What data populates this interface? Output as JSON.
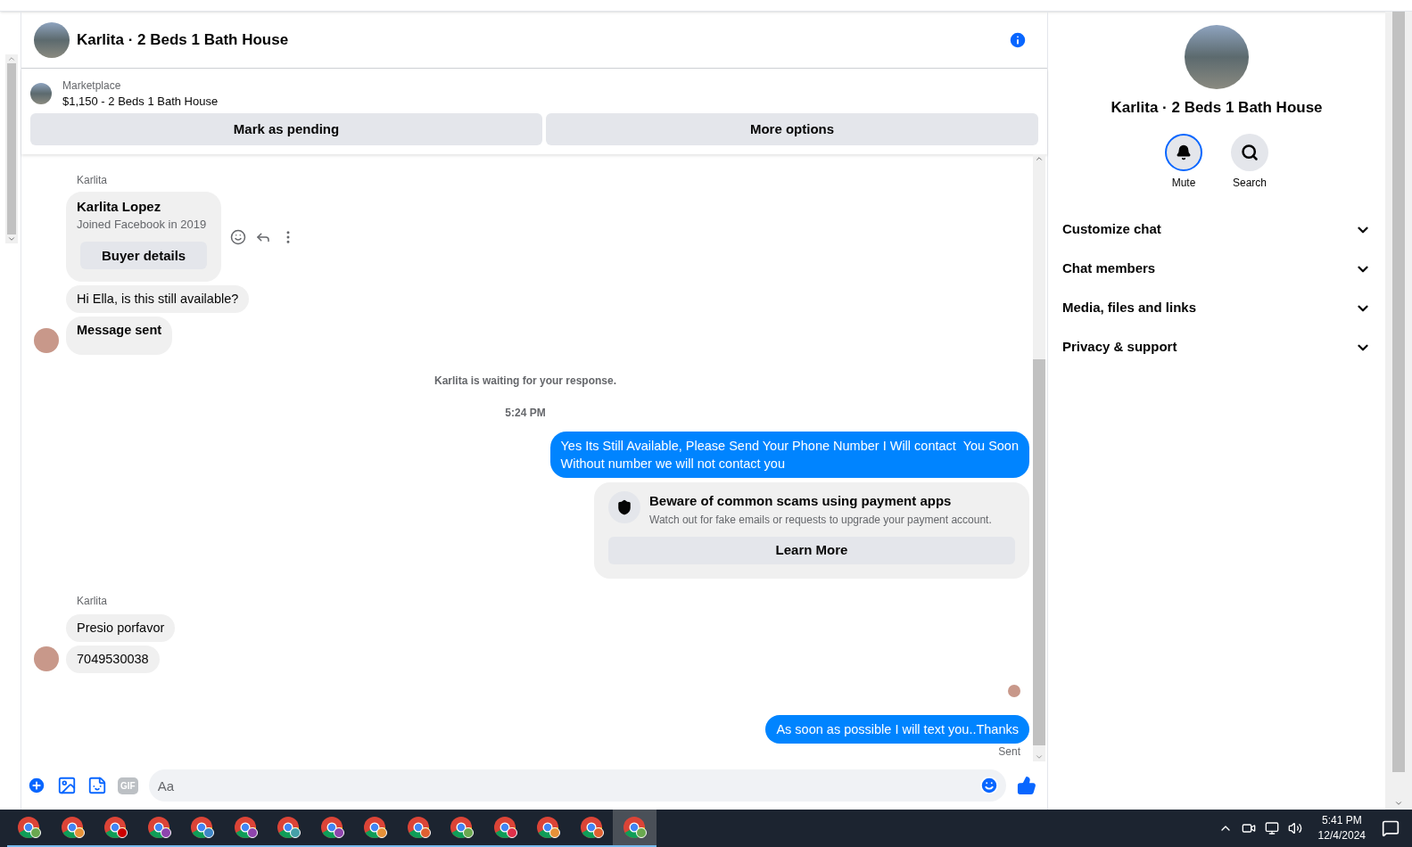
{
  "chat": {
    "title": "Karlita · 2 Beds 1 Bath House",
    "listing": {
      "source": "Marketplace",
      "title": "$1,150 - 2 Beds 1 Bath House"
    },
    "actions": [
      "Mark as pending",
      "More options"
    ],
    "messages": [
      {
        "kind": "sender",
        "text": "Karlita"
      },
      {
        "kind": "buyer_card",
        "name": "Karlita Lopez",
        "subtitle": "Joined Facebook in 2019",
        "button": "Buyer details"
      },
      {
        "kind": "incoming",
        "text": "Hi Ella, is this still available?",
        "emphasis": false
      },
      {
        "kind": "incoming",
        "text": "Message sent",
        "emphasis": true
      },
      {
        "kind": "notice",
        "text": "Karlita is waiting for your response."
      },
      {
        "kind": "timestamp",
        "text": "5:24 PM"
      },
      {
        "kind": "outgoing",
        "text": "Yes Its Still Available, Please Send Your Phone Number I Will contact  You Soon\nWithout number we will not contact you"
      },
      {
        "kind": "safety_notice",
        "title": "Beware of common scams using payment apps",
        "body": "Watch out for fake emails or requests to upgrade your payment account.",
        "button": "Learn More"
      },
      {
        "kind": "sender",
        "text": "Karlita"
      },
      {
        "kind": "incoming",
        "text": "Presio porfavor",
        "emphasis": false
      },
      {
        "kind": "incoming",
        "text": "7049530038",
        "emphasis": false
      },
      {
        "kind": "read_receipt"
      },
      {
        "kind": "outgoing",
        "text": "As soon as possible I will text you..Thanks"
      },
      {
        "kind": "status",
        "text": "Sent"
      }
    ],
    "composer": {
      "gif_label": "GIF",
      "placeholder": "Aa"
    }
  },
  "details": {
    "title": "Karlita · 2 Beds 1 Bath House",
    "actions": [
      {
        "label": "Mute",
        "selected": true
      },
      {
        "label": "Search",
        "selected": false
      }
    ],
    "sections": [
      {
        "label": "Customize chat",
        "expanded": false
      },
      {
        "label": "Chat members",
        "expanded": false
      },
      {
        "label": "Media, files and links",
        "expanded": false
      },
      {
        "label": "Privacy & support",
        "expanded": false
      }
    ]
  },
  "taskbar": {
    "apps": [
      {
        "color": "#6aa84f",
        "selected": false
      },
      {
        "color": "#e69138",
        "selected": false
      },
      {
        "color": "#cc0000",
        "selected": false
      },
      {
        "color": "#8e44ad",
        "selected": false
      },
      {
        "color": "#3d85c6",
        "selected": false
      },
      {
        "color": "#8e44ad",
        "selected": false
      },
      {
        "color": "#45a0a8",
        "selected": false
      },
      {
        "color": "#8e44ad",
        "selected": false
      },
      {
        "color": "#e69138",
        "selected": false
      },
      {
        "color": "#e06030",
        "selected": false
      },
      {
        "color": "#6aa84f",
        "selected": false
      },
      {
        "color": "#e0304a",
        "selected": false
      },
      {
        "color": "#e69138",
        "selected": false
      },
      {
        "color": "#e06030",
        "selected": false
      },
      {
        "color": "#6aa84f",
        "selected": true
      }
    ],
    "time": "5:41 PM",
    "date": "12/4/2024"
  }
}
